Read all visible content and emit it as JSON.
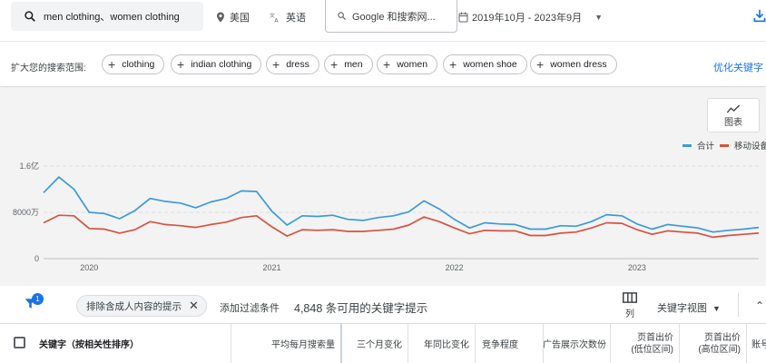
{
  "search": {
    "query": "men clothing、women clothing"
  },
  "location": "美国",
  "language": "英语",
  "network": "Google 和搜索网...",
  "date_range": "2019年10月 - 2023年9月",
  "refine": {
    "label": "扩大您的搜索范围:",
    "chips": [
      "clothing",
      "indian clothing",
      "dress",
      "men",
      "women",
      "women shoe",
      "women dress"
    ],
    "optimize_label": "优化关键字"
  },
  "chart_button_label": "图表",
  "colors": {
    "total": "#3b9ad9",
    "mobile": "#d9513f",
    "accent": "#1a73e8"
  },
  "chart_data": {
    "type": "line",
    "x": [
      "2019-10",
      "2019-11",
      "2019-12",
      "2020-01",
      "2020-02",
      "2020-03",
      "2020-04",
      "2020-05",
      "2020-06",
      "2020-07",
      "2020-08",
      "2020-09",
      "2020-10",
      "2020-11",
      "2020-12",
      "2021-01",
      "2021-02",
      "2021-03",
      "2021-04",
      "2021-05",
      "2021-06",
      "2021-07",
      "2021-08",
      "2021-09",
      "2021-10",
      "2021-11",
      "2021-12",
      "2022-01",
      "2022-02",
      "2022-03",
      "2022-04",
      "2022-05",
      "2022-06",
      "2022-07",
      "2022-08",
      "2022-09",
      "2022-10",
      "2022-11",
      "2022-12",
      "2023-01",
      "2023-02",
      "2023-03",
      "2023-04",
      "2023-05",
      "2023-06",
      "2023-07",
      "2023-08",
      "2023-09"
    ],
    "x_tick_labels": [
      "2020",
      "2021",
      "2022",
      "2023"
    ],
    "y_tick_labels": [
      "0",
      "8000万",
      "1.6亿"
    ],
    "ylim": [
      0,
      16000
    ],
    "y_unit": "万",
    "legend_position": "top-right",
    "grid": true,
    "series": [
      {
        "name": "合计",
        "values": [
          11400,
          14100,
          12000,
          8000,
          7800,
          6900,
          8300,
          10400,
          9900,
          9600,
          8800,
          9800,
          10400,
          11700,
          11600,
          8200,
          5800,
          7400,
          7300,
          7500,
          6800,
          6600,
          7100,
          7400,
          8100,
          10000,
          8600,
          6800,
          5300,
          6200,
          6000,
          5900,
          5100,
          5100,
          5700,
          5600,
          6400,
          7600,
          7400,
          6000,
          5100,
          5900,
          5600,
          5300,
          4600,
          4900,
          5100,
          5400
        ]
      },
      {
        "name": "移动设备",
        "values": [
          6200,
          7500,
          7400,
          5200,
          5100,
          4400,
          5000,
          6400,
          5900,
          5700,
          5400,
          5900,
          6300,
          7100,
          7400,
          5500,
          3900,
          5000,
          4900,
          5000,
          4700,
          4700,
          4900,
          5100,
          5800,
          7200,
          6400,
          5300,
          4300,
          4900,
          4800,
          4800,
          4000,
          4000,
          4400,
          4600,
          5300,
          6200,
          6100,
          5000,
          4200,
          4800,
          4600,
          4400,
          3700,
          4000,
          4200,
          4400
        ]
      }
    ]
  },
  "filter_row": {
    "badge_count": "1",
    "active_filter": "排除含成人内容的提示",
    "add_filter": "添加过滤条件",
    "result_count": "4,848 条可用的关键字提示",
    "columns_label": "列",
    "view_label": "关键字视图"
  },
  "table": {
    "headers": {
      "keyword": "关键字（按相关性排序）",
      "avg_searches": "平均每月搜索量",
      "three_month": "三个月变化",
      "yoy": "年同比变化",
      "competition": "竞争程度",
      "ad_share": "广告展示次数份",
      "bid_low_1": "页首出价",
      "bid_low_2": "(低位区间)",
      "bid_high_1": "页首出价",
      "bid_high_2": "(高位区间)",
      "account": "账号"
    }
  }
}
